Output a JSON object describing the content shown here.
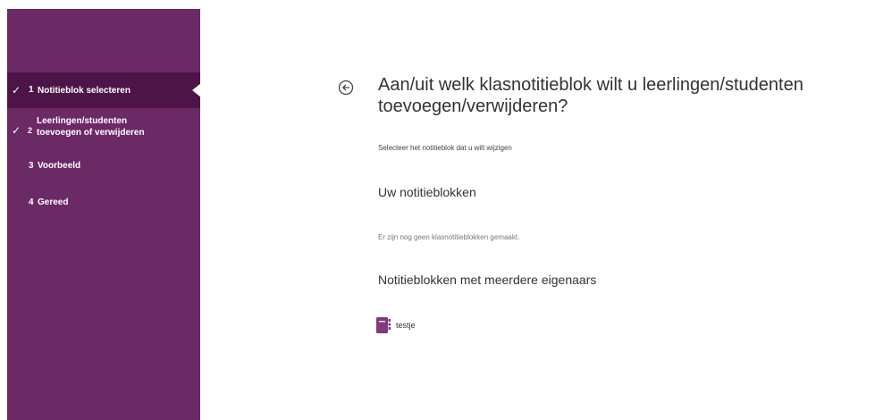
{
  "sidebar": {
    "steps": [
      {
        "check": "✓",
        "number": "1",
        "label": "Notitieblok selecteren",
        "state": "active"
      },
      {
        "check": "✓",
        "number": "2",
        "label": "Leerlingen/studenten toevoegen of verwijderen",
        "state": "done"
      },
      {
        "check": "",
        "number": "3",
        "label": "Voorbeeld",
        "state": "pending"
      },
      {
        "check": "",
        "number": "4",
        "label": "Gereed",
        "state": "pending"
      }
    ]
  },
  "main": {
    "back_icon": "arrow-left-circle-icon",
    "title": "Aan/uit welk klasnotitieblok wilt u leerlingen/studenten toevoegen/verwijderen?",
    "subtitle": "Selecteer het notitieblok dat u wilt wijzigen",
    "my_notebooks": {
      "heading": "Uw notitieblokken",
      "empty_text": "Er zijn nog geen klasnotitieblokken gemaakt."
    },
    "multi_owner_notebooks": {
      "heading": "Notitieblokken met meerdere eigenaars",
      "items": [
        {
          "icon": "onenote-notebook-icon",
          "label": "testje"
        }
      ]
    }
  },
  "colors": {
    "sidebar": "#6b2966",
    "sidebar_active": "#4d1547",
    "notebook_icon": "#80397b",
    "text": "#333333"
  }
}
